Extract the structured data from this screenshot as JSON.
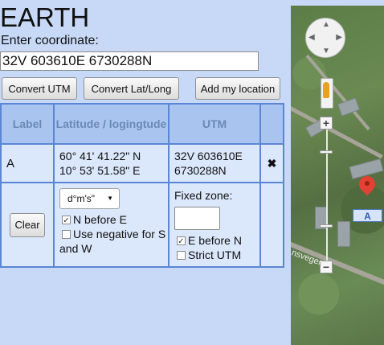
{
  "app": {
    "title": "EARTH"
  },
  "coordinate": {
    "label": "Enter coordinate:",
    "value": "32V 603610E 6730288N"
  },
  "buttons": {
    "convert_utm": "Convert UTM",
    "convert_latlong": "Convert Lat/Long",
    "add_location": "Add my location"
  },
  "table": {
    "headers": {
      "label": "Label",
      "latlong": "Latitude / logingtude",
      "utm": "UTM"
    },
    "rows": [
      {
        "label": "A",
        "lat": "60° 41' 41.22\" N",
        "lon": "10° 53' 51.58\" E",
        "utm_line1": "32V 603610E",
        "utm_line2": "6730288N",
        "remove_icon": "x-icon"
      }
    ]
  },
  "options": {
    "clear_label": "Clear",
    "format_select": "d°m's\"",
    "n_before_e": {
      "label": "N before E",
      "checked": true
    },
    "use_negative": {
      "label": "Use negative for S and W",
      "checked": false
    },
    "fixed_zone_label": "Fixed zone:",
    "fixed_zone_value": "",
    "e_before_n": {
      "label": "E before N",
      "checked": true
    },
    "strict_utm": {
      "label": "Strict UTM",
      "checked": false
    }
  },
  "map": {
    "marker_label": "A",
    "street_name": "nsvegen",
    "zoom_in": "+",
    "zoom_out": "−"
  },
  "colors": {
    "background": "#c8d9f7",
    "table_border": "#5a86d4",
    "header_bg": "#a9c4ef",
    "header_text": "#6a89b6",
    "marker": "#e34133"
  }
}
